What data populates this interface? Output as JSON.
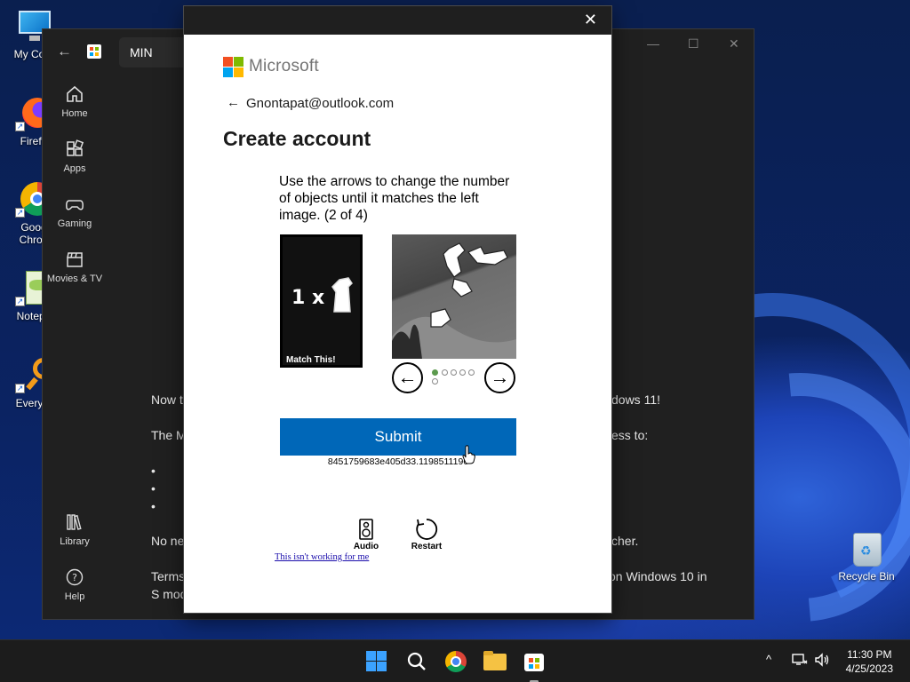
{
  "desktop": {
    "icons": [
      {
        "label": "My Com",
        "icon": "monitor-icon"
      },
      {
        "label": "Firefo",
        "icon": "firefox-icon"
      },
      {
        "label": "Goog",
        "label2": "Chron",
        "icon": "chrome-icon"
      },
      {
        "label": "Notepa",
        "icon": "notepad-icon"
      },
      {
        "label": "Everyth",
        "icon": "everything-search-icon"
      },
      {
        "label": "Recycle Bin",
        "icon": "recycle-bin-icon"
      }
    ]
  },
  "store": {
    "search_value": "MIN",
    "nav": [
      {
        "label": "Home",
        "icon": "home-icon"
      },
      {
        "label": "Apps",
        "icon": "apps-icon"
      },
      {
        "label": "Gaming",
        "icon": "gamepad-icon"
      },
      {
        "label": "Movies & TV",
        "icon": "clapperboard-icon"
      },
      {
        "label": "Library",
        "icon": "library-icon"
      },
      {
        "label": "Help",
        "icon": "help-icon"
      }
    ],
    "body_fragments": [
      {
        "left": "Now t",
        "right": "dows 11!"
      },
      {
        "left": "The M",
        "right": "ess to:"
      },
      {
        "left": "No ne",
        "right": "cher."
      },
      {
        "left": "Terms",
        "right": "on Windows 10 in"
      },
      {
        "left": "S mod",
        "right": ""
      }
    ],
    "bullets": [
      "•",
      "•",
      "•"
    ]
  },
  "dialog": {
    "close_label": "✕",
    "brand": "Microsoft",
    "back_arrow": "←",
    "email": "Gnontapat@outlook.com",
    "title": "Create account",
    "instruction": "Use the arrows to change the number of objects until it matches the left image. (2 of 4)",
    "match_label": "Match This!",
    "match_glyph": "1 x",
    "prev_arrow": "←",
    "next_arrow": "→",
    "page_dots": {
      "total": 6,
      "active": 1
    },
    "submit_label": "Submit",
    "session_id": "8451759683e405d33.1198511196",
    "audio_label": "Audio",
    "restart_label": "Restart",
    "help_link": "This isn't working for me",
    "logo_colors": [
      "#f25022",
      "#7fba00",
      "#00a4ef",
      "#ffb900"
    ],
    "accent": "#0067b8"
  },
  "taskbar": {
    "time": "11:30 PM",
    "date": "4/25/2023",
    "tray_chevron": "^"
  }
}
